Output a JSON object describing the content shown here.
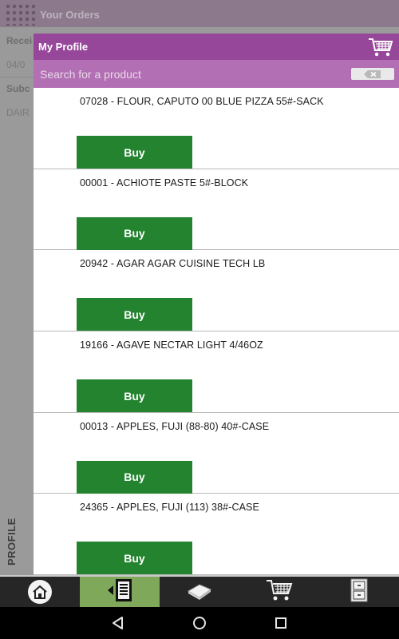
{
  "background": {
    "app_title": "Your Orders",
    "rows": [
      "Recei",
      "04/0",
      "Subc",
      "DAIR"
    ],
    "side_tab": "PROFILE"
  },
  "panel": {
    "title": "My Profile",
    "search_placeholder": "Search for a product",
    "cart_icon": "cart-icon",
    "clear_icon": "clear-backspace-icon"
  },
  "products": [
    {
      "name": "07028 - FLOUR, CAPUTO 00 BLUE PIZZA 55#-SACK",
      "buy_label": "Buy"
    },
    {
      "name": "00001 - ACHIOTE PASTE 5#-BLOCK",
      "buy_label": "Buy"
    },
    {
      "name": "20942 - AGAR AGAR CUISINE TECH LB",
      "buy_label": "Buy"
    },
    {
      "name": "19166 - AGAVE NECTAR LIGHT 4/46OZ",
      "buy_label": "Buy"
    },
    {
      "name": "00013 - APPLES, FUJI (88-80) 40#-CASE",
      "buy_label": "Buy"
    },
    {
      "name": "24365 - APPLES, FUJI (113) 38#-CASE",
      "buy_label": "Buy"
    }
  ],
  "bottom_nav": [
    {
      "icon": "home-icon",
      "active": false
    },
    {
      "icon": "order-list-icon",
      "active": true
    },
    {
      "icon": "catalog-book-icon",
      "active": false
    },
    {
      "icon": "cart-icon",
      "active": false
    },
    {
      "icon": "cabinet-icon",
      "active": false
    }
  ],
  "system_nav": [
    "back-icon",
    "home-circle-icon",
    "recents-icon"
  ],
  "colors": {
    "header_purple": "#97479a",
    "search_purple": "#b26fb3",
    "buy_green": "#23832f",
    "nav_active": "#7fa85b"
  }
}
